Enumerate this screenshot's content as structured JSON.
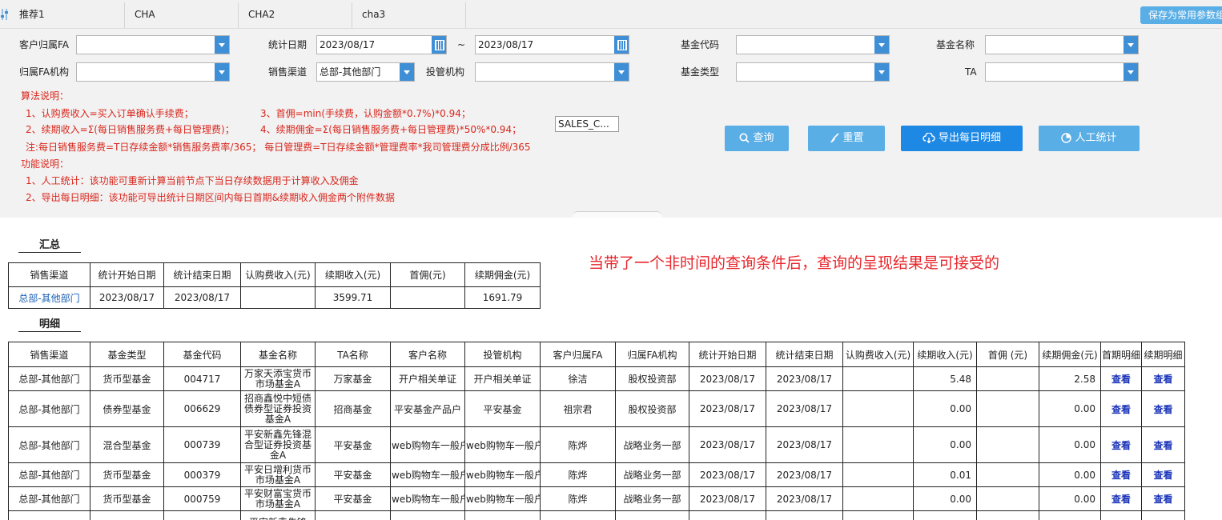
{
  "tabs": [
    "推荐1",
    "CHA",
    "CHA2",
    "cha3"
  ],
  "save_label": "保存为常用参数组",
  "filters": {
    "customer_fa": "客户归属FA",
    "stat_date": "统计日期",
    "date_from": "2023/08/17",
    "tilde": "~",
    "date_to": "2023/08/17",
    "fund_code": "基金代码",
    "fund_name": "基金名称",
    "fa_org": "归属FA机构",
    "channel": "销售渠道",
    "channel_value": "总部-其他部门",
    "custodian": "投管机构",
    "fund_type": "基金类型",
    "ta": "TA"
  },
  "notes": {
    "algo_title": "算法说明：",
    "l1": "1、认购费收入=买入订单确认手续费；",
    "l3": "3、首佣=min(手续费，认购金额*0.7%)*0.94；",
    "l2": "2、续期收入=Σ(每日销售服务费+每日管理费)；",
    "l4": "4、续期佣金=Σ(每日销售服务费+每日管理费)*50%*0.94；",
    "ln": "注:每日销售服务费=T日存续金额*销售服务费率/365； 每日管理费=T日存续金额*管理费率*我司管理费分成比例/365",
    "func_title": "功能说明：",
    "f1": "1、人工统计：该功能可重新计算当前节点下当日存续数据用于计算收入及佣金",
    "f2": "2、导出每日明细：该功能可导出统计日期区间内每日首期&续期收入佣金两个附件数据"
  },
  "sales_box": "SALES_C...",
  "buttons": {
    "query": "查询",
    "reset": "重置",
    "export": "导出每日明细",
    "manual": "人工统计"
  },
  "summary_title": "汇总",
  "detail_title": "明细",
  "annotation": "当带了一个非时间的查询条件后，查询的呈现结果是可接受的",
  "summary_headers": [
    "销售渠道",
    "统计开始日期",
    "统计结束日期",
    "认购费收入(元)",
    "续期收入(元)",
    "首佣(元)",
    "续期佣金(元)"
  ],
  "summary_row": [
    "总部-其他部门",
    "2023/08/17",
    "2023/08/17",
    "",
    "3599.71",
    "",
    "1691.79"
  ],
  "detail_headers": [
    "销售渠道",
    "基金类型",
    "基金代码",
    "基金名称",
    "TA名称",
    "客户名称",
    "投管机构",
    "客户归属FA",
    "归属FA机构",
    "统计开始日期",
    "统计结束日期",
    "认购费收入(元)",
    "续期收入(元)",
    "首佣 (元)",
    "续期佣金(元)",
    "首期明细",
    "续期明细"
  ],
  "detail_rows": [
    [
      "总部-其他部门",
      "货币型基金",
      "004717",
      "万家天添宝货币市场基金A",
      "万家基金",
      "开户相关单证",
      "开户相关单证",
      "徐洁",
      "股权投资部",
      "2023/08/17",
      "2023/08/17",
      "",
      "5.48",
      "",
      "2.58",
      "查看",
      "查看"
    ],
    [
      "总部-其他部门",
      "债券型基金",
      "006629",
      "招商鑫悦中短债债券型证券投资基金A",
      "招商基金",
      "平安基金产品户",
      "平安基金",
      "祖宗君",
      "股权投资部",
      "2023/08/17",
      "2023/08/17",
      "",
      "0.00",
      "",
      "0.00",
      "查看",
      "查看"
    ],
    [
      "总部-其他部门",
      "混合型基金",
      "000739",
      "平安新鑫先锋混合型证券投资基金A",
      "平安基金",
      "web购物车一般户",
      "web购物车一般户",
      "陈烨",
      "战略业务一部",
      "2023/08/17",
      "2023/08/17",
      "",
      "0.00",
      "",
      "0.00",
      "查看",
      "查看"
    ],
    [
      "总部-其他部门",
      "货币型基金",
      "000379",
      "平安日增利货币市场基金A",
      "平安基金",
      "web购物车一般户",
      "web购物车一般户",
      "陈烨",
      "战略业务一部",
      "2023/08/17",
      "2023/08/17",
      "",
      "0.01",
      "",
      "0.00",
      "查看",
      "查看"
    ],
    [
      "总部-其他部门",
      "货币型基金",
      "000759",
      "平安财富宝货币市场基金A",
      "平安基金",
      "web购物车一般户",
      "web购物车一般户",
      "陈烨",
      "战略业务一部",
      "2023/08/17",
      "2023/08/17",
      "",
      "0.00",
      "",
      "0.00",
      "查看",
      "查看"
    ],
    [
      "",
      "",
      "",
      "平安新鑫先锋",
      "",
      "",
      "",
      "",
      "",
      "",
      "",
      "",
      "",
      "",
      "",
      "",
      ""
    ]
  ]
}
